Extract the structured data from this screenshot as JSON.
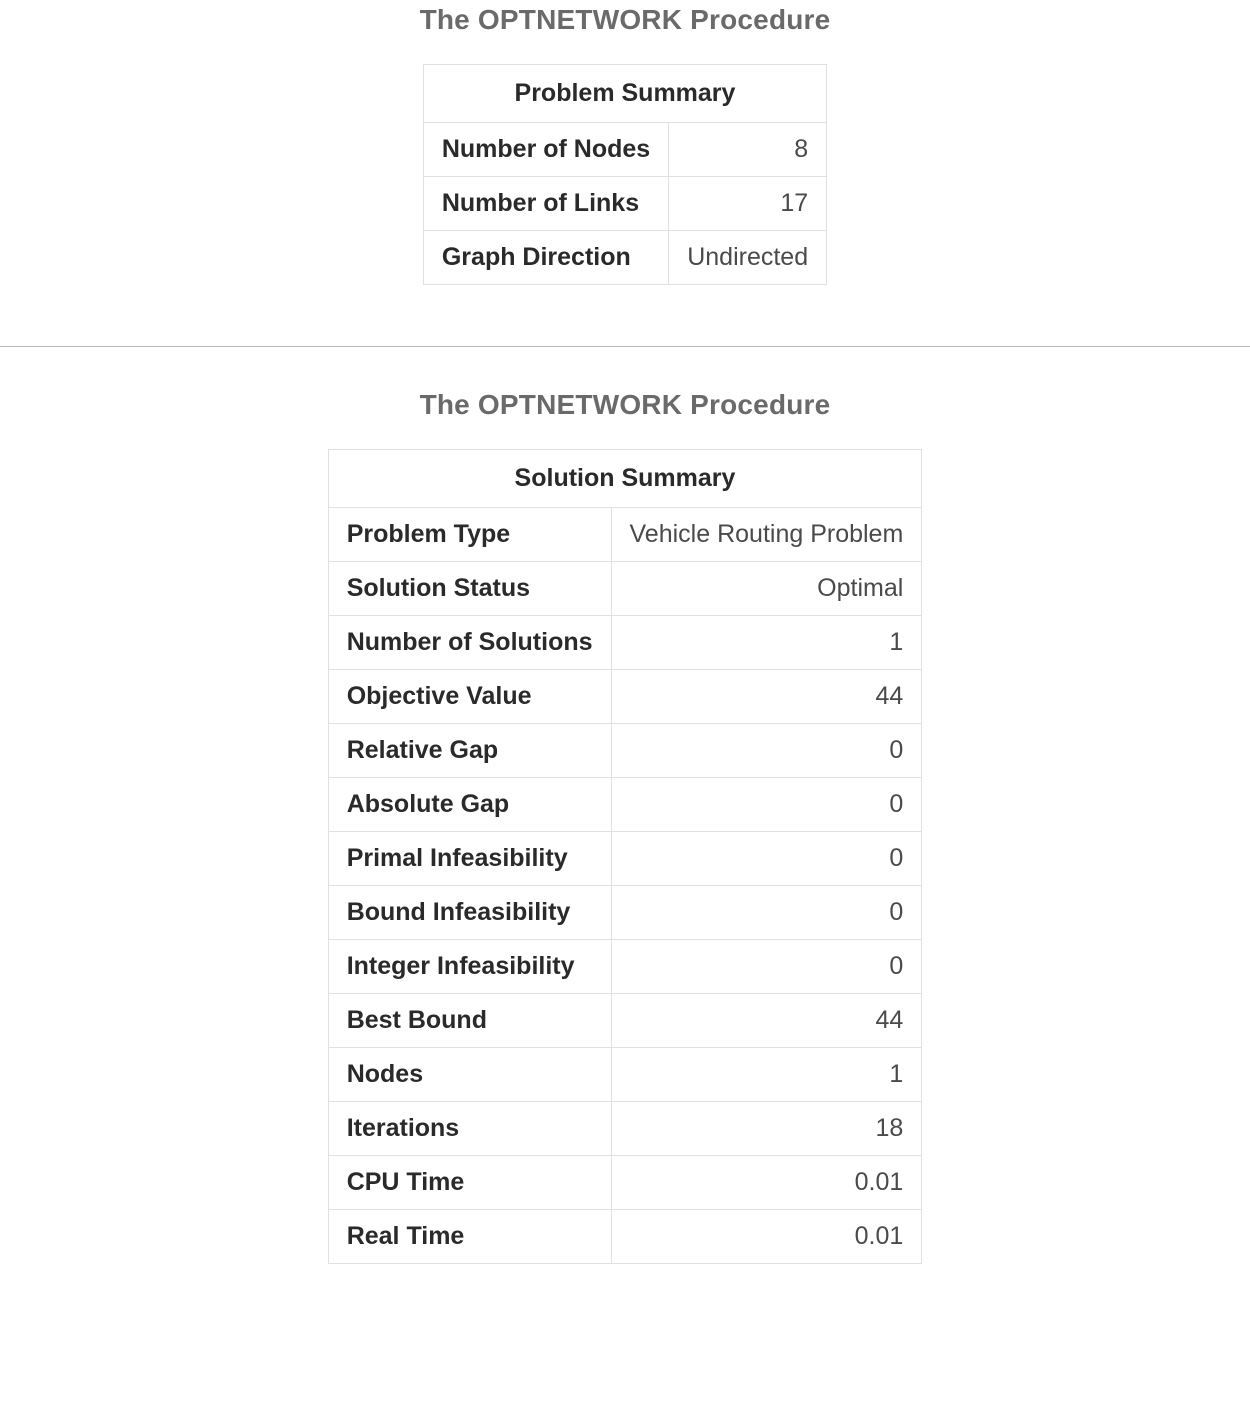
{
  "section1": {
    "title": "The OPTNETWORK Procedure",
    "table_caption": "Problem Summary",
    "rows": [
      {
        "label": "Number of Nodes",
        "value": "8"
      },
      {
        "label": "Number of Links",
        "value": "17"
      },
      {
        "label": "Graph Direction",
        "value": "Undirected"
      }
    ]
  },
  "section2": {
    "title": "The OPTNETWORK Procedure",
    "table_caption": "Solution Summary",
    "rows": [
      {
        "label": "Problem Type",
        "value": "Vehicle Routing Problem"
      },
      {
        "label": "Solution Status",
        "value": "Optimal"
      },
      {
        "label": "Number of Solutions",
        "value": "1"
      },
      {
        "label": "Objective Value",
        "value": "44"
      },
      {
        "label": "Relative Gap",
        "value": "0"
      },
      {
        "label": "Absolute Gap",
        "value": "0"
      },
      {
        "label": "Primal Infeasibility",
        "value": "0"
      },
      {
        "label": "Bound Infeasibility",
        "value": "0"
      },
      {
        "label": "Integer Infeasibility",
        "value": "0"
      },
      {
        "label": "Best Bound",
        "value": "44"
      },
      {
        "label": "Nodes",
        "value": "1"
      },
      {
        "label": "Iterations",
        "value": "18"
      },
      {
        "label": "CPU Time",
        "value": "0.01"
      },
      {
        "label": "Real Time",
        "value": "0.01"
      }
    ]
  }
}
